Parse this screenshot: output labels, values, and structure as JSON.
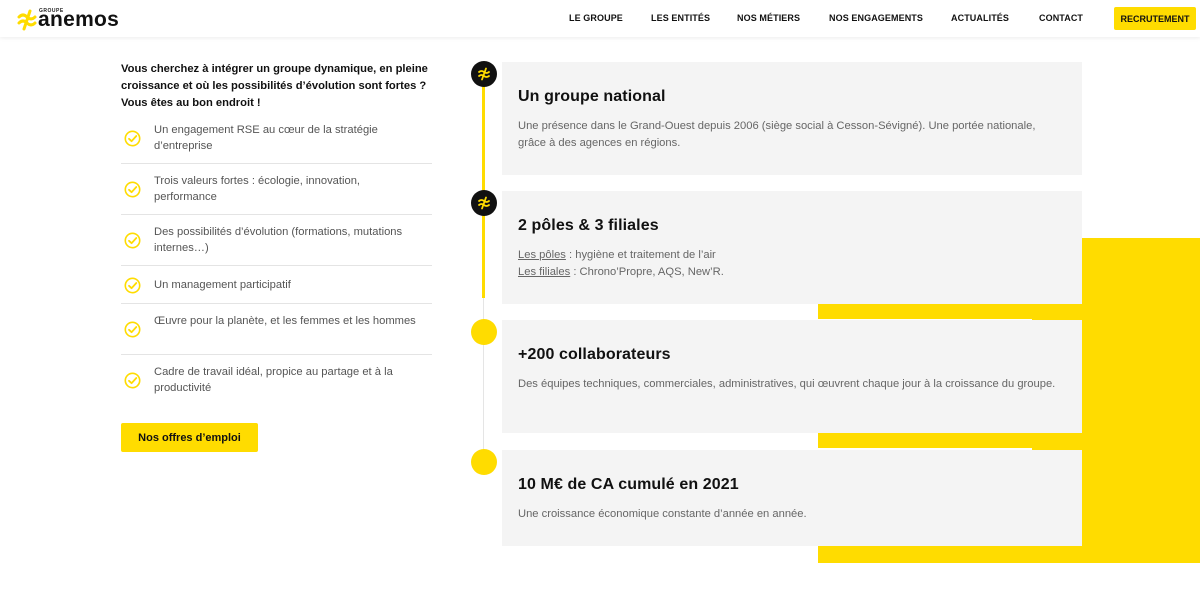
{
  "header": {
    "logo_small": "GROUPE",
    "logo_text": "anemos",
    "nav": [
      "LE GROUPE",
      "LES ENTITÉS",
      "NOS MÉTIERS",
      "NOS ENGAGEMENTS",
      "ACTUALITÉS",
      "CONTACT"
    ],
    "cta": "RECRUTEMENT"
  },
  "intro": "Vous cherchez à intégrer un groupe dynamique, en pleine croissance et où les possibilités d’évolution sont fortes ? Vous êtes au bon endroit !",
  "benefits": [
    "Un engagement RSE au cœur de la stratégie d’entreprise",
    "Trois valeurs fortes : écologie, innovation, performance",
    "Des possibilités d’évolution (formations, mutations internes…)",
    "Un management participatif",
    "Œuvre pour la planète, et les femmes et les hommes",
    "Cadre de travail idéal, propice au partage et à la productivité"
  ],
  "offers_button": "Nos offres d’emploi",
  "cards": [
    {
      "title": "Un groupe national",
      "text": "Une présence dans le Grand-Ouest depuis 2006 (siège social à Cesson-Sévigné). Une portée nationale, grâce à des agences en régions."
    },
    {
      "title": "2 pôles & 3 filiales",
      "line1_link": "Les pôles",
      "line1_text": " : hygiène et traitement de l’air",
      "line2_link": "Les filiales",
      "line2_text": " : Chrono’Propre, AQS, New’R."
    },
    {
      "title": "+200 collaborateurs",
      "text": "Des équipes techniques, commerciales, administratives, qui œuvrent chaque jour à la croissance du groupe."
    },
    {
      "title": "10 M€ de CA cumulé en 2021",
      "text": "Une croissance économique constante d’année en année."
    }
  ],
  "colors": {
    "accent": "#ffdc00",
    "dark": "#111111",
    "card_bg": "#f4f4f4"
  }
}
